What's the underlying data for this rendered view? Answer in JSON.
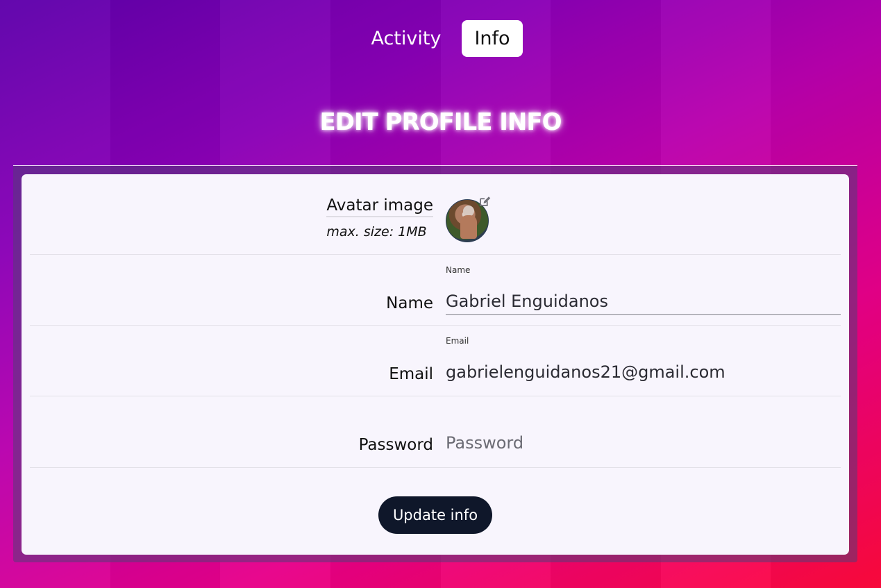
{
  "tabs": [
    {
      "label": "Activity",
      "active": false
    },
    {
      "label": "Info",
      "active": true
    }
  ],
  "page_title": "EDIT PROFILE INFO",
  "form": {
    "avatar": {
      "label": "Avatar image",
      "hint": "max. size: 1MB"
    },
    "name": {
      "label": "Name",
      "floating_label": "Name",
      "value": "Gabriel Enguidanos"
    },
    "email": {
      "label": "Email",
      "floating_label": "Email",
      "value": "gabrielenguidanos21@gmail.com"
    },
    "password": {
      "label": "Password",
      "placeholder": "Password",
      "value": ""
    },
    "submit_label": "Update info"
  },
  "icons": {
    "edit": "edit-pencil-icon"
  },
  "colors": {
    "button_bg": "#0f172a",
    "card_bg": "#f8f5fd",
    "active_tab_bg": "#ffffff"
  }
}
